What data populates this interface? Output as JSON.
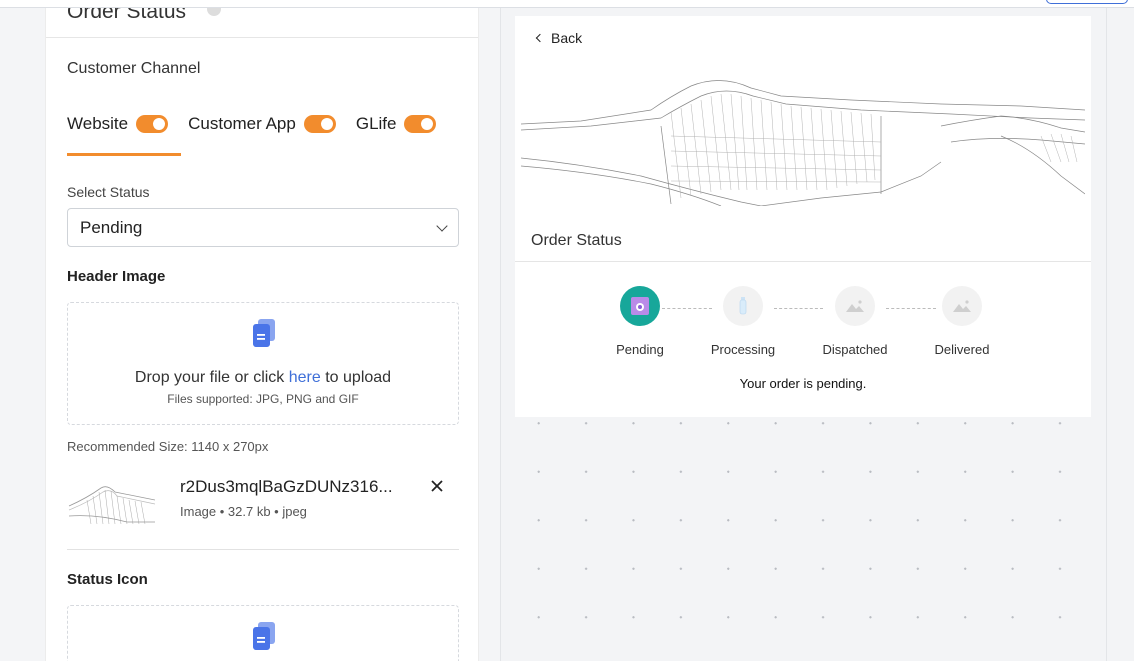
{
  "left_panel": {
    "title": "Order Status",
    "customer_channel_label": "Customer Channel",
    "channels": [
      {
        "label": "Website",
        "enabled": true
      },
      {
        "label": "Customer App",
        "enabled": true
      },
      {
        "label": "GLife",
        "enabled": true
      }
    ],
    "select_status_label": "Select Status",
    "selected_status": "Pending",
    "header_image_label": "Header Image",
    "upload": {
      "prompt_before": "Drop your file or click ",
      "prompt_link": "here",
      "prompt_after": " to upload",
      "supported": "Files supported: JPG, PNG and GIF"
    },
    "recommended_size": "Recommended Size: 1140 x 270px",
    "uploaded_file": {
      "name": "r2Dus3mqlBaGzDUNz316...",
      "meta": "Image • 32.7 kb • jpeg"
    },
    "status_icon_label": "Status Icon"
  },
  "preview": {
    "back_label": "Back",
    "card_title": "Order Status",
    "steps": [
      {
        "label": "Pending",
        "state": "active"
      },
      {
        "label": "Processing",
        "state": "inactive"
      },
      {
        "label": "Dispatched",
        "state": "inactive"
      },
      {
        "label": "Delivered",
        "state": "inactive"
      }
    ],
    "message": "Your order is pending."
  },
  "colors": {
    "accent_orange": "#f28c2d",
    "active_step": "#17a79a",
    "link_blue": "#3f6fd8",
    "file_icon_blue": "#4a74e8"
  }
}
